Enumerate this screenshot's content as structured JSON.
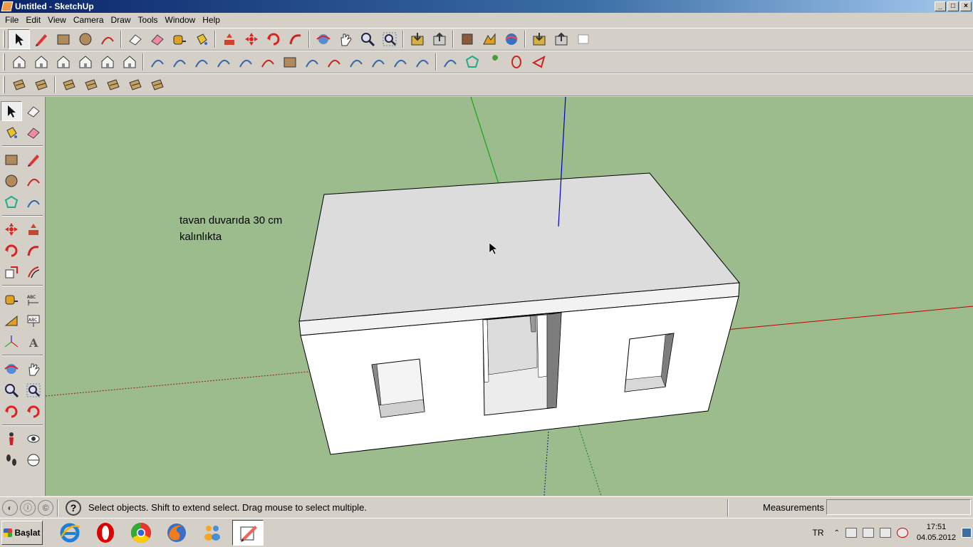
{
  "window": {
    "title": "Untitled - SketchUp",
    "min_label": "_",
    "max_label": "□",
    "close_label": "×"
  },
  "menu": [
    "File",
    "Edit",
    "View",
    "Camera",
    "Draw",
    "Tools",
    "Window",
    "Help"
  ],
  "toolbar_icons": {
    "row1": [
      "select-icon",
      "pencil-icon",
      "rectangle-icon",
      "circle-icon",
      "arc-icon",
      "|",
      "eraser-icon",
      "eraser-pink-icon",
      "tape-measure-icon",
      "paint-bucket-icon",
      "|",
      "push-pull-icon",
      "move-icon",
      "rotate-icon",
      "follow-me-icon",
      "|",
      "orbit-icon",
      "pan-icon",
      "zoom-icon",
      "zoom-extents-icon",
      "|",
      "get-models-icon",
      "share-model-icon",
      "|",
      "component-icon",
      "terrain-icon",
      "warehouse-icon",
      "|",
      "import-icon",
      "export-icon",
      "layout-icon"
    ],
    "row2": [
      "iso-view-icon",
      "top-view-icon",
      "front-view-icon",
      "right-view-icon",
      "back-view-icon",
      "left-view-icon",
      "|",
      "bezier-icon",
      "spline-icon",
      "polyline-icon",
      "curve1-icon",
      "curve2-icon",
      "arc2-icon",
      "rect2-icon",
      "spiral-icon",
      "arc3-icon",
      "curve3-icon",
      "curve4-icon",
      "curve5-icon",
      "curve6-icon",
      "|",
      "freehand-icon",
      "polygon-icon",
      "wrench-icon",
      "ellipse-icon",
      "cone-icon"
    ],
    "row3": [
      "sandbox-from-contours-icon",
      "sandbox-from-scratch-icon",
      "|",
      "smoove-icon",
      "stamp-icon",
      "drape-icon",
      "add-detail-icon",
      "flip-edge-icon"
    ]
  },
  "left_toolbar": [
    "select-icon",
    "eraser-icon",
    "paint-bucket-icon",
    "eraser-pink-icon",
    "-",
    "rectangle-icon",
    "pencil-icon",
    "circle-icon",
    "arc-icon",
    "polygon-icon",
    "freehand-icon",
    "-",
    "move-icon",
    "push-pull-icon",
    "rotate-icon",
    "follow-me-icon",
    "scale-icon",
    "offset-icon",
    "-",
    "tape-measure-icon",
    "dimension-icon",
    "protractor-icon",
    "text-icon",
    "axes-icon",
    "3d-text-icon",
    "-",
    "orbit-icon",
    "pan-icon",
    "zoom-icon",
    "zoom-window-icon",
    "previous-view-icon",
    "next-view-icon",
    "-",
    "position-camera-icon",
    "look-around-icon",
    "walk-icon",
    "section-plane-icon"
  ],
  "viewport": {
    "note": "tavan duvarıda 30 cm\nkalınlıkta"
  },
  "status": {
    "hint": "Select objects. Shift to extend select. Drag mouse to select multiple.",
    "measurements_label": "Measurements",
    "measurements_value": ""
  },
  "taskbar": {
    "start_label": "Başlat",
    "apps": [
      "internet-explorer-icon",
      "opera-icon",
      "chrome-icon",
      "firefox-icon",
      "people-icon",
      "sketchup-icon"
    ],
    "lang": "TR",
    "time": "17:51",
    "date": "04.05.2012"
  },
  "colors": {
    "sky": "#9dbc8e",
    "title_start": "#0a246a",
    "title_end": "#a6caf0",
    "axis_red": "#c00000",
    "axis_green": "#00a000",
    "axis_blue": "#0000c0"
  }
}
